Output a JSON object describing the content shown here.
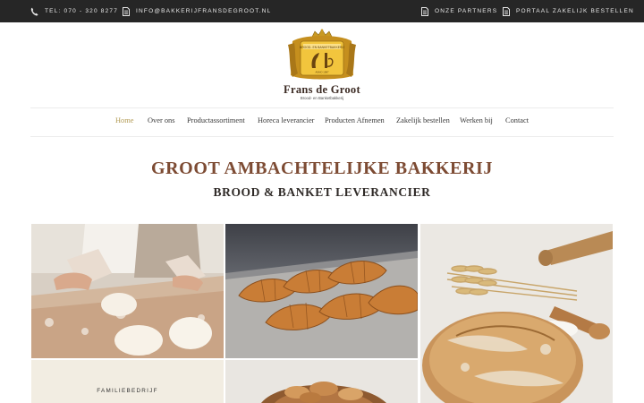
{
  "topbar": {
    "phone": "TEL: 070 - 320 8277",
    "email": "INFO@BAKKERIJFRANSDEGROOT.NL",
    "partners": "ONZE PARTNERS",
    "portal": "PORTAAL ZAKELIJK BESTELLEN"
  },
  "brand": {
    "name": "Frans de Groot",
    "tagline": "Brood- en Banketbakkerij",
    "logo_color": "#e9b83a"
  },
  "nav": {
    "items": [
      {
        "label": "Home",
        "active": true
      },
      {
        "label": "Over ons"
      },
      {
        "label": "Productassortiment"
      },
      {
        "label": "Horeca leverancier"
      },
      {
        "label": "Producten Afnemen"
      },
      {
        "label": "Zakelijk bestellen"
      },
      {
        "label": "Werken bij"
      },
      {
        "label": "Contact"
      }
    ]
  },
  "hero": {
    "title": "GROOT AMBACHTELIJKE BAKKERIJ",
    "subtitle": "BROOD & BANKET LEVERANCIER"
  },
  "gallery": {
    "caption": "FAMILIEBEDRIJF"
  },
  "colors": {
    "topbar_bg": "#262626",
    "accent": "#b29a53",
    "heading": "#7d4b33"
  }
}
